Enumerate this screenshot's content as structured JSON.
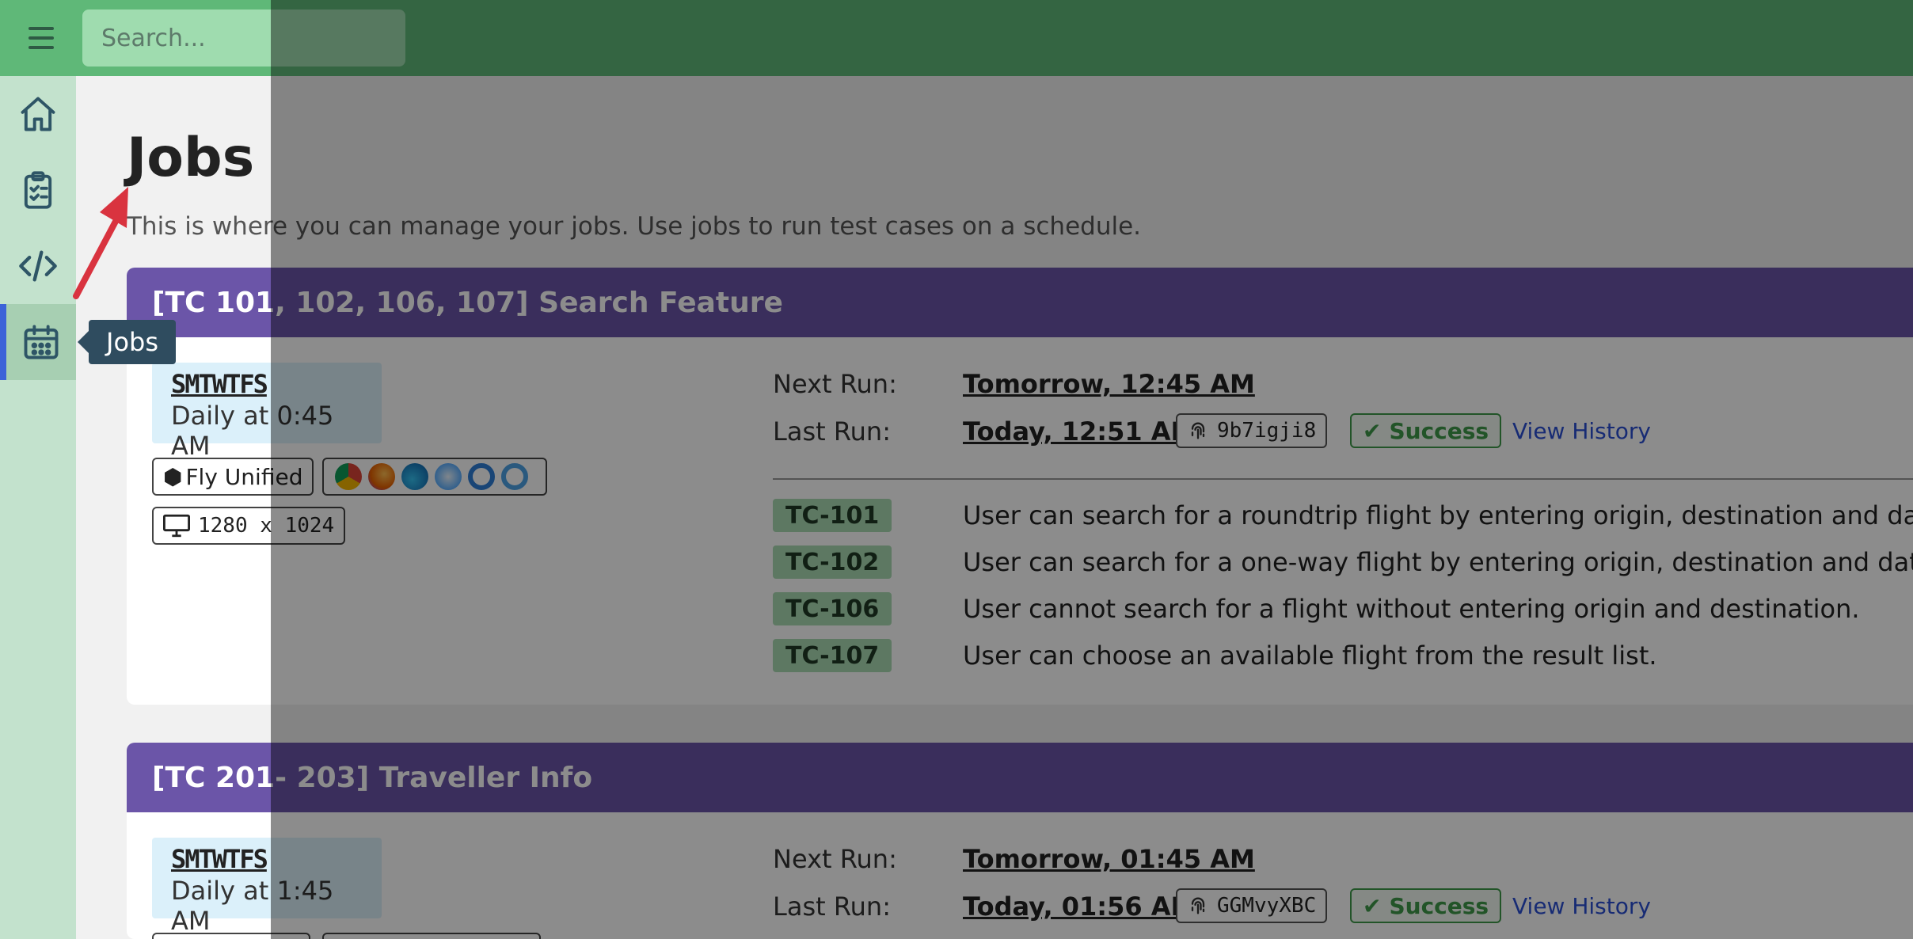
{
  "search": {
    "placeholder": "Search..."
  },
  "sidebar": {
    "items": [
      {
        "icon": "home-icon"
      },
      {
        "icon": "clipboard-icon"
      },
      {
        "icon": "code-icon"
      },
      {
        "icon": "calendar-icon",
        "active": true
      }
    ],
    "tooltip": "Jobs"
  },
  "page": {
    "title": "Jobs",
    "description": "This is where you can manage your jobs. Use jobs to run test cases on a schedule."
  },
  "jobs": [
    {
      "title": "[TC 101, 102, 106, 107] Search Feature",
      "days": "SMTWTFS",
      "schedule": "Daily at 0:45 AM",
      "project": "Fly Unified",
      "browsers": [
        "chrome",
        "firefox",
        "edge",
        "safari",
        "edge-legacy",
        "ie"
      ],
      "resolution": "1280 x 1024",
      "next_run_label": "Next Run:",
      "next_run": "Tomorrow, 12:45 AM",
      "last_run_label": "Last Run:",
      "last_run": "Today, 12:51 AM",
      "run_id": "9b7igji8",
      "status": "Success",
      "history_link": "View History",
      "test_cases": [
        {
          "id": "TC-101",
          "text": "User can search for a roundtrip flight by entering origin, destination and dates."
        },
        {
          "id": "TC-102",
          "text": "User can search for a one-way flight by entering origin, destination and dates."
        },
        {
          "id": "TC-106",
          "text": "User cannot search for a flight without entering origin and destination."
        },
        {
          "id": "TC-107",
          "text": "User can choose an available flight from the result list."
        }
      ]
    },
    {
      "title": "[TC 201- 203] Traveller Info",
      "days": "SMTWTFS",
      "schedule": "Daily at 1:45 AM",
      "next_run_label": "Next Run:",
      "next_run": "Tomorrow, 01:45 AM",
      "last_run_label": "Last Run:",
      "last_run": "Today, 01:56 AM",
      "run_id": "GGMvyXBC",
      "status": "Success",
      "history_link": "View History"
    }
  ],
  "colors": {
    "topbar": "#5fb878",
    "sidebar": "#c3e2cd",
    "card_header": "#6b55a8",
    "success": "#3f9a4a",
    "tc_badge": "#a9dbb3",
    "link": "#2b4fd4",
    "active_indicator": "#3c63d8",
    "annotation_arrow": "#d9333f"
  }
}
